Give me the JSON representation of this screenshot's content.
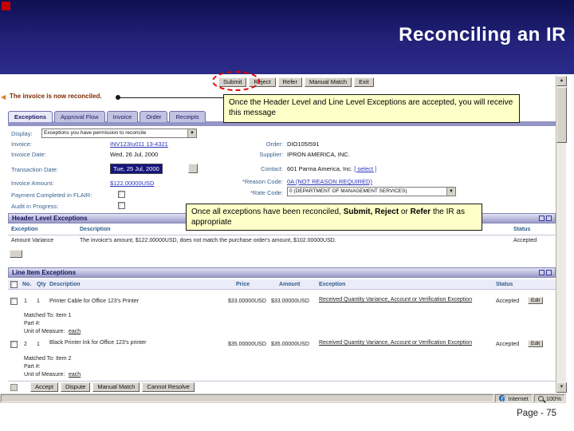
{
  "slide": {
    "title": "Reconciling an IR",
    "page_label": "Page - 75"
  },
  "annotations": {
    "callout1": "Once the Header Level and Line Level Exceptions are accepted, you will receive this message",
    "callout2": {
      "part1": "Once all exceptions have been reconciled, ",
      "bold1": "Submit, Reject",
      "part2": " or ",
      "bold2": "Refer",
      "part3": " the IR as appropriate"
    }
  },
  "icons": {
    "dropdown_arrow": "▼",
    "scroll_up": "▲",
    "scroll_down": "▼",
    "back": "◀"
  },
  "app": {
    "toolbar": {
      "submit": "Submit",
      "reject": "Reject",
      "refer": "Refer",
      "manual_match": "Manual Match",
      "exit": "Exit"
    },
    "status_message": "The invoice is now reconciled.",
    "tabs": [
      {
        "label": "Exceptions"
      },
      {
        "label": "Approval Flow"
      },
      {
        "label": "Invoice"
      },
      {
        "label": "Order"
      },
      {
        "label": "Receipts"
      }
    ],
    "display": {
      "label": "Display:",
      "value": "Exceptions you have permission to reconcile"
    },
    "invoice_fields": {
      "invoice_label": "Invoice:",
      "invoice_value": "INV123Iu011 13-4321",
      "invoice_date_label": "Invoice Date:",
      "invoice_date_value": "Wed, 26 Jul, 2000",
      "transaction_date_label": "Transaction Date:",
      "transaction_date_value": "Tue, 25 Jul, 2000",
      "invoice_amount_label": "Invoice Amount:",
      "invoice_amount_value": "$122.00000USD",
      "payment_completed_label": "Payment Completed in FLAIR:",
      "audit_label": "Audit in Progress:"
    },
    "order_fields": {
      "order_label": "Order:",
      "order_value": "DIO105I591",
      "supplier_label": "Supplier:",
      "supplier_value": "IPRON AMERICA, INC.",
      "contact_label": "Contact:",
      "contact_value": "601 Parma America, Inc.",
      "contact_select": "[ select ]",
      "reason_code_label": "*Reason Code:",
      "reason_code_value": "0A (NOT REASON REQUIRED)",
      "rate_code_label": "*Rate Code:",
      "rate_code_value": "0 (DEPARTMENT OF MANAGEMENT SERVICES)"
    },
    "header_exceptions": {
      "title": "Header Level Exceptions",
      "columns": {
        "exception": "Exception",
        "description": "Description",
        "status": "Status"
      },
      "rows": [
        {
          "exception": "Amount Variance",
          "description": "The invoice's amount, $122.00000USD, does not match the purchase order's amount, $102.00000USD.",
          "status": "Accepted"
        }
      ]
    },
    "line_exceptions": {
      "title": "Line Item Exceptions",
      "columns": {
        "no": "No.",
        "qty": "Qty",
        "description": "Description",
        "price": "Price",
        "amount": "Amount",
        "exception": "Exception",
        "status": "Status"
      },
      "rows": [
        {
          "no": "1",
          "qty": "1",
          "description": "Printer Cable for Office 123's Printer",
          "price": "$33.00000USD",
          "amount": "$33.00000USD",
          "exception": "Received Quantity Variance, Account or Verification Exception",
          "status": "Accepted",
          "edit_label": "Edit",
          "matched_to": "Matched To: Item 1",
          "part": "Part #:",
          "uom_label": "Unit of Measure:",
          "uom_value": "each"
        },
        {
          "no": "2",
          "qty": "1",
          "description": "Black Printer Ink for Office 123's printer",
          "price": "$35.00000USD",
          "amount": "$35.00000USD",
          "exception": "Received Quantity Variance, Account or Verification Exception",
          "status": "Accepted",
          "edit_label": "Edit",
          "matched_to": "Matched To: Item 2",
          "part": "Part #:",
          "uom_label": "Unit of Measure:",
          "uom_value": "each"
        }
      ]
    },
    "footer_buttons": {
      "accept": "Accept",
      "dispute": "Dispute",
      "manual_match": "Manual Match",
      "cannot_resolve": "Cannot Resolve"
    },
    "statusbar": {
      "zone": "Internet",
      "zoom": "100%"
    }
  }
}
